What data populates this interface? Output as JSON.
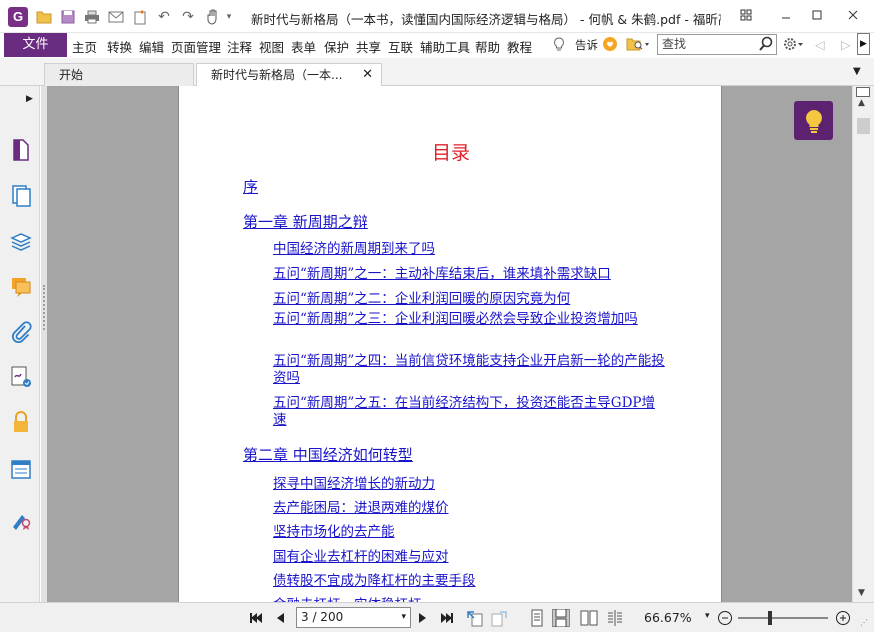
{
  "window": {
    "title": "新时代与新格局（一本书，读懂国内国际经济逻辑与格局） - 何帆 & 朱鹤.pdf - 福昕高...",
    "app_logo": "G"
  },
  "menu": {
    "file": "文件",
    "items": [
      "主页",
      "转换",
      "编辑",
      "页面管理",
      "注释",
      "视图",
      "表单",
      "保护",
      "共享",
      "互联",
      "辅助工具",
      "帮助",
      "教程"
    ],
    "tell_me": "告诉",
    "search_placeholder": "查找"
  },
  "tabs": [
    {
      "label": "开始"
    },
    {
      "label": "新时代与新格局（一本..."
    }
  ],
  "document": {
    "toc_title": "目录",
    "entries": [
      {
        "text": "序"
      },
      {
        "text": "第一章 新周期之辩"
      },
      {
        "text": "中国经济的新周期到来了吗"
      },
      {
        "text": "五问“新周期”之一：主动补库结束后，谁来填补需求缺口"
      },
      {
        "text": "五问“新周期”之二：企业利润回暖的原因究竟为何"
      },
      {
        "text": "五问“新周期”之三：企业利润回暖必然会导致企业投资增加吗"
      },
      {
        "text": "五问“新周期”之四：当前信贷环境能支持企业开启新一轮的产能投资吗"
      },
      {
        "text": "五问“新周期”之五：在当前经济结构下，投资还能否主导GDP增速"
      },
      {
        "text": "第二章 中国经济如何转型"
      },
      {
        "text": "探寻中国经济增长的新动力"
      },
      {
        "text": "去产能困局：进退两难的煤价"
      },
      {
        "text": "坚持市场化的去产能"
      },
      {
        "text": "国有企业去杠杆的困难与应对"
      },
      {
        "text": "债转股不宜成为降杠杆的主要手段"
      },
      {
        "text": "金融去杠杆，实体稳杠杆"
      }
    ]
  },
  "status": {
    "page_indicator": "3 / 200",
    "zoom": "66.67%"
  },
  "colors": {
    "accent": "#6a2c80",
    "link": "#1a14c9",
    "toc_title": "#e0212a"
  }
}
